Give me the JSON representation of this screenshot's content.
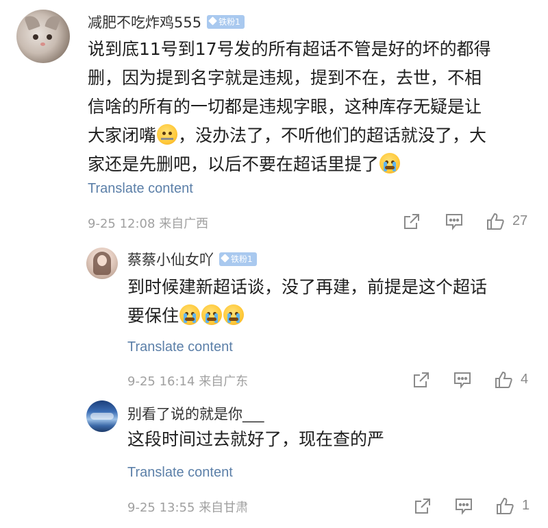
{
  "comments": [
    {
      "username": "减肥不吃炸鸡555",
      "badge": "铁粉1",
      "text_lines": [
        "说到底11号到17号发的所有超话不管是好的坏的都得",
        "删，因为提到名字就是违规，提到不在，去世，不相",
        "信啥的所有的一切都是违规字眼，这种库存无疑是让",
        "大家闭嘴",
        "，没办法了，不听他们的超话就没了，大",
        "家还是先删吧，以后不要在超话里提了"
      ],
      "translate_label": "Translate content",
      "timestamp": "9-25 12:08",
      "location": "来自广西",
      "likes": "27",
      "emojis": [
        "zipper-mouth-emoji",
        "crying-emoji"
      ]
    },
    {
      "username": "蔡蔡小仙女吖",
      "badge": "铁粉1",
      "text_lines": [
        "到时候建新超话谈，没了再建，前提是这个超话",
        "要保住"
      ],
      "translate_label": "Translate content",
      "timestamp": "9-25 16:14",
      "location": "来自广东",
      "likes": "4",
      "emojis": [
        "crying-emoji",
        "crying-emoji",
        "crying-emoji"
      ]
    },
    {
      "username": "别看了说的就是你___",
      "badge": "",
      "text_lines": [
        "这段时间过去就好了，现在查的严"
      ],
      "translate_label": "Translate content",
      "timestamp": "9-25 13:55",
      "location": "来自甘肃",
      "likes": "1",
      "emojis": []
    }
  ],
  "colors": {
    "link": "#5b7fa8",
    "meta": "#a0a0a0",
    "badge": "#a9c9ef",
    "icon": "#8a8a8a"
  },
  "icons": [
    "share-icon",
    "comment-icon",
    "like-icon"
  ]
}
